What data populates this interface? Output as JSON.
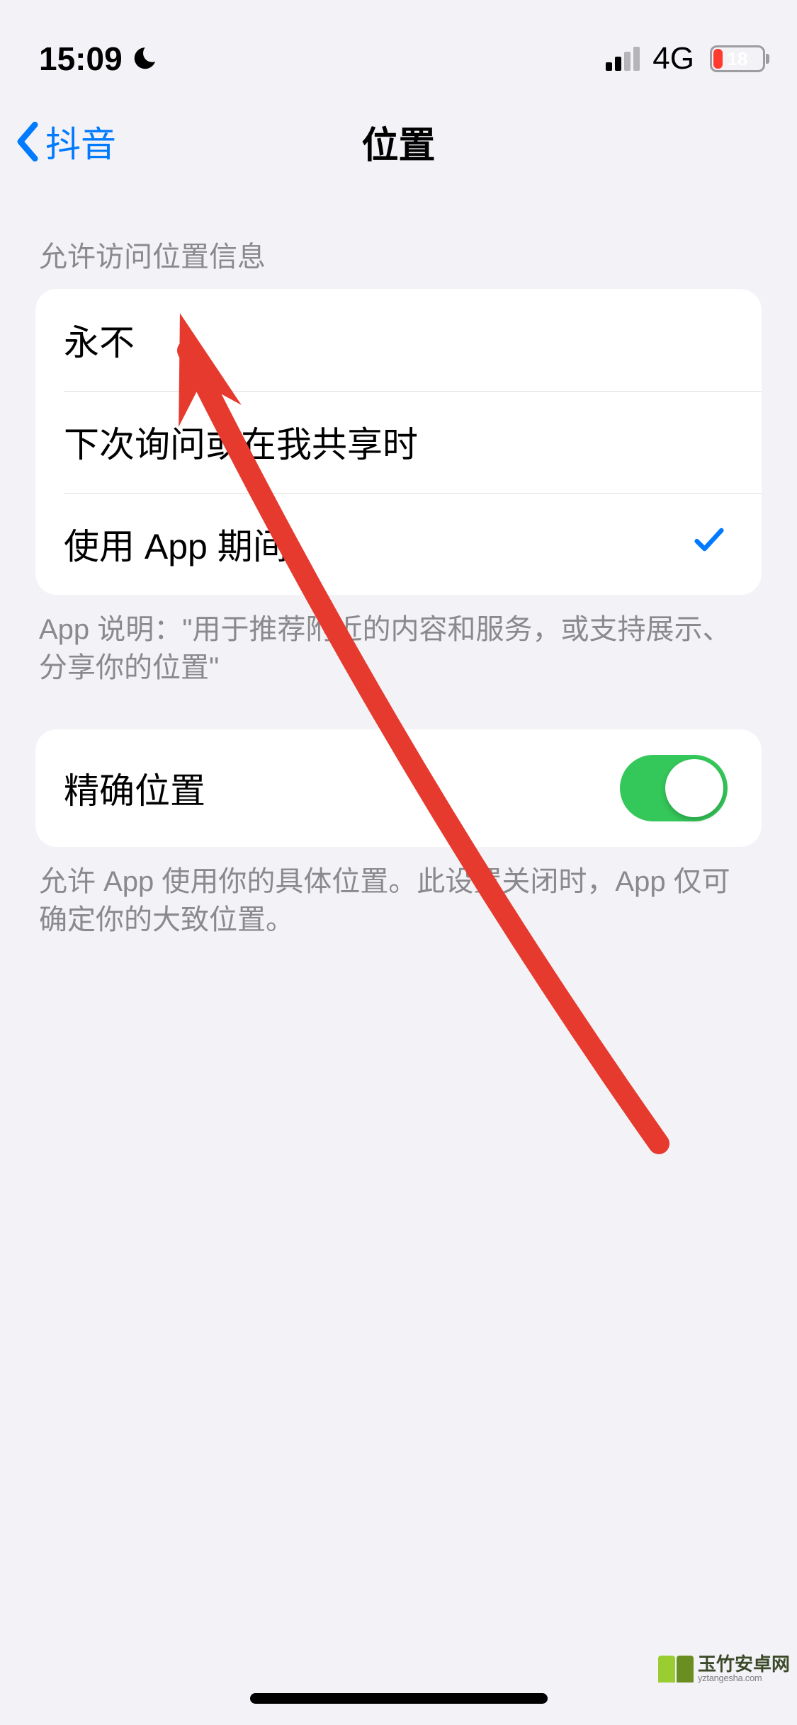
{
  "status_bar": {
    "time": "15:09",
    "network_label": "4G",
    "battery_percent": "18"
  },
  "nav": {
    "back_label": "抖音",
    "title": "位置"
  },
  "location_access": {
    "header": "允许访问位置信息",
    "options": [
      {
        "label": "永不",
        "selected": false
      },
      {
        "label": "下次询问或在我共享时",
        "selected": false
      },
      {
        "label": "使用 App 期间",
        "selected": true
      }
    ],
    "footer": "App 说明：\"用于推荐附近的内容和服务，或支持展示、分享你的位置\""
  },
  "precise_location": {
    "label": "精确位置",
    "enabled": true,
    "footer": "允许 App 使用你的具体位置。此设置关闭时，App 仅可确定你的大致位置。"
  },
  "watermark": {
    "name": "玉竹安卓网",
    "url": "yztangesha.com"
  }
}
